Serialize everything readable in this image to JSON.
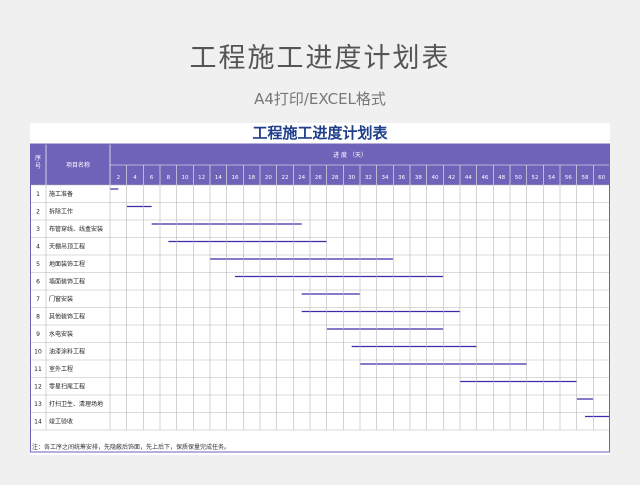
{
  "header": {
    "title": "工程施工进度计划表",
    "subtitle": "A4打印/EXCEL格式"
  },
  "sheet": {
    "title": "工程施工进度计划表",
    "col_seq": "序号",
    "col_name": "项目名称",
    "progress_label": "进      度          （天）",
    "days": [
      2,
      4,
      6,
      8,
      10,
      12,
      14,
      16,
      18,
      20,
      22,
      24,
      26,
      28,
      30,
      32,
      34,
      36,
      38,
      40,
      42,
      44,
      46,
      48,
      50,
      52,
      54,
      56,
      58,
      60
    ],
    "tasks": [
      {
        "no": "1",
        "name": "施工准备",
        "start": 0,
        "end": 1
      },
      {
        "no": "2",
        "name": "拆除工作",
        "start": 2,
        "end": 5
      },
      {
        "no": "3",
        "name": "布管穿线、线盒安装",
        "start": 5,
        "end": 23
      },
      {
        "no": "4",
        "name": "天棚吊顶工程",
        "start": 7,
        "end": 26
      },
      {
        "no": "5",
        "name": "地面装饰工程",
        "start": 12,
        "end": 34
      },
      {
        "no": "6",
        "name": "墙面装饰工程",
        "start": 15,
        "end": 40
      },
      {
        "no": "7",
        "name": "门窗安装",
        "start": 23,
        "end": 30
      },
      {
        "no": "8",
        "name": "其他装饰工程",
        "start": 23,
        "end": 42
      },
      {
        "no": "9",
        "name": "水电安装",
        "start": 26,
        "end": 40
      },
      {
        "no": "10",
        "name": "油漆涂料工程",
        "start": 29,
        "end": 44
      },
      {
        "no": "11",
        "name": "室外工程",
        "start": 30,
        "end": 50
      },
      {
        "no": "12",
        "name": "零星扫尾工程",
        "start": 42,
        "end": 56
      },
      {
        "no": "13",
        "name": "打扫卫生、清理场地",
        "start": 56,
        "end": 58
      },
      {
        "no": "14",
        "name": "竣工验收",
        "start": 57,
        "end": 60
      }
    ],
    "note": "注：各工序之间统筹安排，先隐蔽后饰面，先上后下，保质保量完成任务。",
    "colors": {
      "header": "#6f62b9",
      "grid": "#b8b8b8",
      "bar": "#3a2ea8",
      "border": "#6f62b9"
    }
  }
}
